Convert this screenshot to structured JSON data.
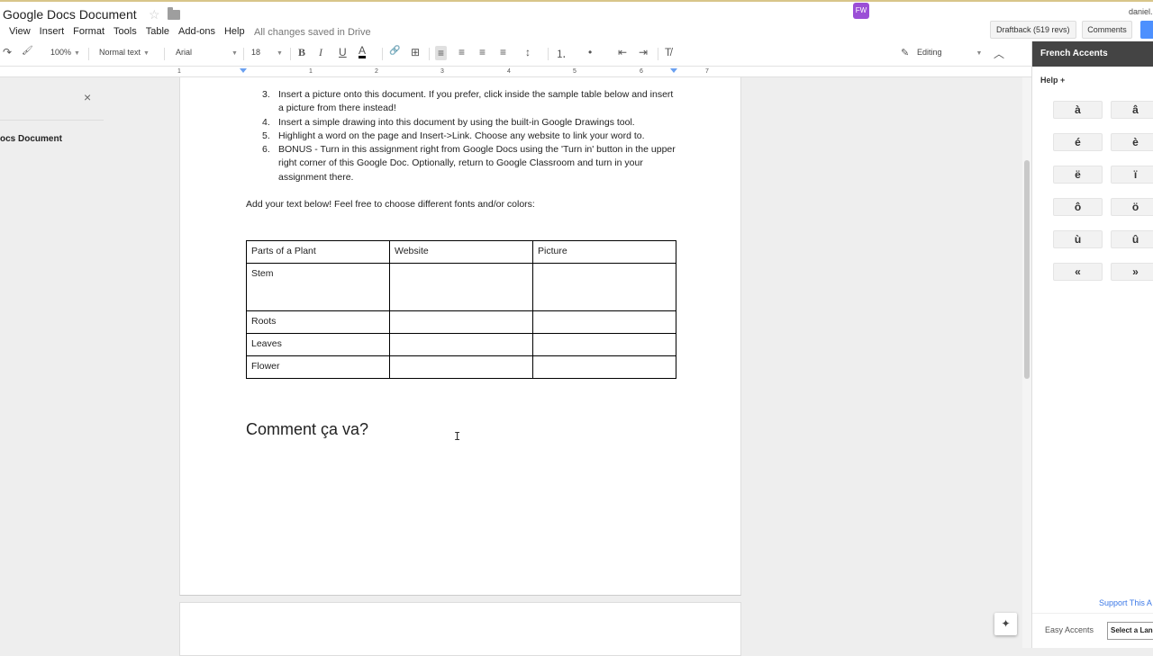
{
  "title_bar": {
    "doc_title": "Google Docs Document",
    "star_icon": "☆",
    "saved_status": "All changes saved in Drive",
    "user": "daniel.",
    "extension_icon_label": "FW",
    "draftback_label": "Draftback (519 revs)",
    "comments_label": "Comments"
  },
  "menu": [
    "View",
    "Insert",
    "Format",
    "Tools",
    "Table",
    "Add-ons",
    "Help"
  ],
  "toolbar": {
    "redo_icon": "↷",
    "paint_icon": "🖌",
    "zoom": "100%",
    "style": "Normal text",
    "font": "Arial",
    "font_size": "18",
    "bold": "B",
    "italic": "I",
    "underline": "U",
    "text_color": "A",
    "link_icon": "🔗",
    "comment_icon": "⊞",
    "align_left": "≡",
    "align_center": "≡",
    "align_right": "≡",
    "align_justify": "≡",
    "line_spacing": "↕",
    "numbered_list": "⒈",
    "bulleted_list": "•",
    "outdent": "⇤",
    "indent": "⇥",
    "clear_format": "T̸",
    "editing": "Editing",
    "pencil_icon": "✎",
    "collapse_icon": "︿"
  },
  "ruler": {
    "numbers": [
      "1",
      "1",
      "2",
      "3",
      "4",
      "5",
      "6",
      "7"
    ]
  },
  "outline": {
    "close_icon": "×",
    "doc_title": "ocs Document"
  },
  "document": {
    "list_items": [
      {
        "num": "3.",
        "text": "Insert a picture onto this document. If you prefer, click inside the sample table below and insert a picture from there instead!"
      },
      {
        "num": "4.",
        "text": "Insert a simple drawing into this document by using the built-in Google Drawings tool."
      },
      {
        "num": "5.",
        "text": "Highlight a word on the page and Insert->Link. Choose any website to link your word to."
      },
      {
        "num": "6.",
        "text": "BONUS - Turn in this assignment right from Google Docs using the 'Turn in' button in the upper right corner of this Google Doc. Optionally, return to Google Classroom and turn in your assignment there."
      }
    ],
    "paragraph": "Add your text below! Feel free to choose different fonts and/or colors:",
    "table": {
      "headers": [
        "Parts of a Plant",
        "Website",
        "Picture"
      ],
      "rows": [
        [
          "Stem",
          "",
          ""
        ],
        [
          "Roots",
          "",
          ""
        ],
        [
          "Leaves",
          "",
          ""
        ],
        [
          "Flower",
          "",
          ""
        ]
      ]
    },
    "heading": "Comment ça va?"
  },
  "sidebar": {
    "title": "French Accents",
    "help": "Help +",
    "accents": [
      "à",
      "â",
      "é",
      "è",
      "ë",
      "ï",
      "ô",
      "ö",
      "ù",
      "û",
      "«",
      "»"
    ],
    "support_link": "Support This A",
    "easy_accents": "Easy Accents",
    "select_language": "Select a Lan",
    "explore_icon": "✦"
  },
  "colors": {
    "sidebar_header": "#444444",
    "share_button": "#4d90fe",
    "link": "#3b78e7"
  }
}
